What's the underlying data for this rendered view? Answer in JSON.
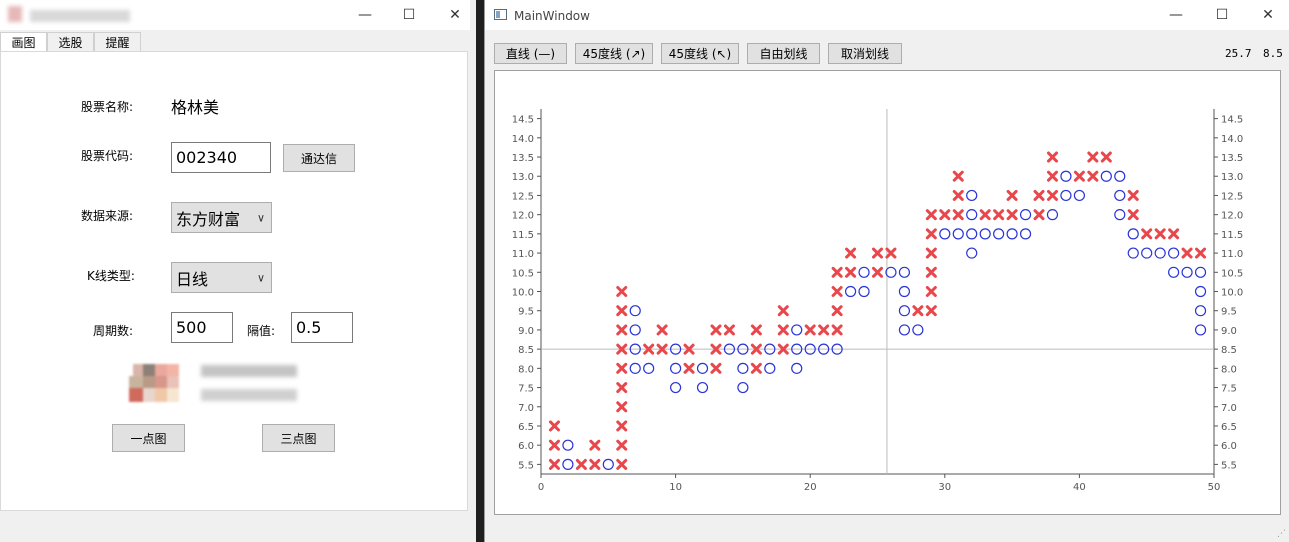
{
  "left_window": {
    "tabs": [
      "画图",
      "选股",
      "提醒"
    ],
    "form": {
      "stock_name_label": "股票名称:",
      "stock_name_value": "格林美",
      "stock_code_label": "股票代码:",
      "stock_code_value": "002340",
      "tdx_button": "通达信",
      "data_source_label": "数据来源:",
      "data_source_value": "东方财富",
      "kline_type_label": "K线类型:",
      "kline_type_value": "日线",
      "period_label": "周期数:",
      "period_value": "500",
      "interval_label": "隔值:",
      "interval_value": "0.5",
      "one_point_button": "一点图",
      "three_point_button": "三点图"
    }
  },
  "right_window": {
    "title": "MainWindow",
    "toolbar": {
      "line_button": "直线 (—)",
      "up45_button": "45度线 (↗)",
      "down45_button": "45度线 (↖)",
      "free_draw_button": "自由划线",
      "cancel_draw_button": "取消划线"
    },
    "coords": {
      "x": "25.7",
      "y": "8.5"
    }
  },
  "chart_data": {
    "type": "scatter",
    "xlim": [
      0,
      50
    ],
    "ylim": [
      5.25,
      14.75
    ],
    "x_ticks": [
      "0",
      "10",
      "20",
      "30",
      "40",
      "50"
    ],
    "y_ticks": [
      "5.5",
      "6.0",
      "6.5",
      "7.0",
      "7.5",
      "8.0",
      "8.5",
      "9.0",
      "9.5",
      "10.0",
      "10.5",
      "11.0",
      "11.5",
      "12.0",
      "12.5",
      "13.0",
      "13.5",
      "14.0",
      "14.5"
    ],
    "crosshair": {
      "x": 25.7,
      "y": 8.5
    },
    "x_color": "#e8474c",
    "o_color": "#2a34d8",
    "columns": [
      {
        "x": 1,
        "type": "X",
        "low": 5.5,
        "high": 6.5
      },
      {
        "x": 2,
        "type": "O",
        "low": 5.5,
        "high": 6.0
      },
      {
        "x": 3,
        "type": "X",
        "low": 5.5,
        "high": 5.5
      },
      {
        "x": 4,
        "type": "X",
        "low": 5.5,
        "high": 6.0
      },
      {
        "x": 5,
        "type": "O",
        "low": 5.5,
        "high": 5.5
      },
      {
        "x": 6,
        "type": "X",
        "low": 5.5,
        "high": 10.0
      },
      {
        "x": 7,
        "type": "O",
        "low": 8.0,
        "high": 9.5
      },
      {
        "x": 8,
        "type": "X",
        "low": 8.5,
        "high": 8.5
      },
      {
        "x": 8,
        "type": "O",
        "low": 8.0,
        "high": 8.0
      },
      {
        "x": 9,
        "type": "X",
        "low": 8.5,
        "high": 9.0
      },
      {
        "x": 10,
        "type": "O",
        "low": 7.5,
        "high": 8.5
      },
      {
        "x": 11,
        "type": "X",
        "low": 8.0,
        "high": 8.5
      },
      {
        "x": 12,
        "type": "O",
        "low": 7.5,
        "high": 8.0
      },
      {
        "x": 13,
        "type": "X",
        "low": 8.0,
        "high": 9.0
      },
      {
        "x": 14,
        "type": "O",
        "low": 8.5,
        "high": 8.5
      },
      {
        "x": 14,
        "type": "X",
        "low": 9.0,
        "high": 9.0
      },
      {
        "x": 15,
        "type": "O",
        "low": 7.5,
        "high": 8.5
      },
      {
        "x": 16,
        "type": "X",
        "low": 8.0,
        "high": 9.0
      },
      {
        "x": 17,
        "type": "O",
        "low": 8.0,
        "high": 8.5
      },
      {
        "x": 18,
        "type": "X",
        "low": 8.5,
        "high": 9.5
      },
      {
        "x": 19,
        "type": "O",
        "low": 8.0,
        "high": 9.0
      },
      {
        "x": 20,
        "type": "X",
        "low": 9.0,
        "high": 9.0
      },
      {
        "x": 20,
        "type": "O",
        "low": 8.5,
        "high": 8.5
      },
      {
        "x": 21,
        "type": "O",
        "low": 8.5,
        "high": 8.5
      },
      {
        "x": 21,
        "type": "X",
        "low": 9.0,
        "high": 9.0
      },
      {
        "x": 22,
        "type": "X",
        "low": 9.0,
        "high": 10.5
      },
      {
        "x": 22,
        "type": "O",
        "low": 8.5,
        "high": 8.5
      },
      {
        "x": 23,
        "type": "X",
        "low": 10.5,
        "high": 11.0
      },
      {
        "x": 23,
        "type": "O",
        "low": 10.0,
        "high": 10.0
      },
      {
        "x": 24,
        "type": "O",
        "low": 10.0,
        "high": 10.5
      },
      {
        "x": 25,
        "type": "X",
        "low": 10.5,
        "high": 11.0
      },
      {
        "x": 26,
        "type": "X",
        "low": 11.0,
        "high": 11.0
      },
      {
        "x": 26,
        "type": "O",
        "low": 10.5,
        "high": 10.5
      },
      {
        "x": 27,
        "type": "O",
        "low": 9.0,
        "high": 10.5
      },
      {
        "x": 28,
        "type": "O",
        "low": 9.0,
        "high": 9.0
      },
      {
        "x": 28,
        "type": "X",
        "low": 9.5,
        "high": 9.5
      },
      {
        "x": 29,
        "type": "X",
        "low": 9.5,
        "high": 12.0
      },
      {
        "x": 30,
        "type": "O",
        "low": 11.5,
        "high": 11.5
      },
      {
        "x": 30,
        "type": "X",
        "low": 12.0,
        "high": 12.0
      },
      {
        "x": 31,
        "type": "O",
        "low": 11.5,
        "high": 11.5
      },
      {
        "x": 31,
        "type": "X",
        "low": 12.0,
        "high": 13.0
      },
      {
        "x": 32,
        "type": "O",
        "low": 11.0,
        "high": 12.5
      },
      {
        "x": 33,
        "type": "X",
        "low": 12.0,
        "high": 12.0
      },
      {
        "x": 33,
        "type": "O",
        "low": 11.5,
        "high": 11.5
      },
      {
        "x": 34,
        "type": "O",
        "low": 11.5,
        "high": 11.5
      },
      {
        "x": 34,
        "type": "X",
        "low": 12.0,
        "high": 12.0
      },
      {
        "x": 35,
        "type": "X",
        "low": 12.0,
        "high": 12.5
      },
      {
        "x": 35,
        "type": "O",
        "low": 11.5,
        "high": 11.5
      },
      {
        "x": 36,
        "type": "O",
        "low": 11.5,
        "high": 12.0
      },
      {
        "x": 37,
        "type": "X",
        "low": 12.0,
        "high": 12.5
      },
      {
        "x": 38,
        "type": "O",
        "low": 12.0,
        "high": 12.0
      },
      {
        "x": 38,
        "type": "X",
        "low": 12.5,
        "high": 13.5
      },
      {
        "x": 39,
        "type": "O",
        "low": 12.5,
        "high": 13.0
      },
      {
        "x": 40,
        "type": "X",
        "low": 13.0,
        "high": 13.0
      },
      {
        "x": 40,
        "type": "O",
        "low": 12.5,
        "high": 12.5
      },
      {
        "x": 41,
        "type": "X",
        "low": 13.0,
        "high": 13.5
      },
      {
        "x": 42,
        "type": "X",
        "low": 13.5,
        "high": 13.5
      },
      {
        "x": 42,
        "type": "O",
        "low": 13.0,
        "high": 13.0
      },
      {
        "x": 43,
        "type": "O",
        "low": 12.0,
        "high": 13.0
      },
      {
        "x": 44,
        "type": "X",
        "low": 12.0,
        "high": 12.5
      },
      {
        "x": 44,
        "type": "O",
        "low": 11.0,
        "high": 11.5
      },
      {
        "x": 45,
        "type": "O",
        "low": 11.0,
        "high": 11.0
      },
      {
        "x": 45,
        "type": "X",
        "low": 11.5,
        "high": 11.5
      },
      {
        "x": 46,
        "type": "X",
        "low": 11.5,
        "high": 11.5
      },
      {
        "x": 46,
        "type": "O",
        "low": 11.0,
        "high": 11.0
      },
      {
        "x": 47,
        "type": "X",
        "low": 11.5,
        "high": 11.5
      },
      {
        "x": 47,
        "type": "O",
        "low": 10.5,
        "high": 11.0
      },
      {
        "x": 48,
        "type": "O",
        "low": 10.5,
        "high": 10.5
      },
      {
        "x": 48,
        "type": "X",
        "low": 11.0,
        "high": 11.0
      },
      {
        "x": 49,
        "type": "X",
        "low": 11.0,
        "high": 11.0
      },
      {
        "x": 49,
        "type": "O",
        "low": 9.0,
        "high": 10.5
      }
    ]
  }
}
